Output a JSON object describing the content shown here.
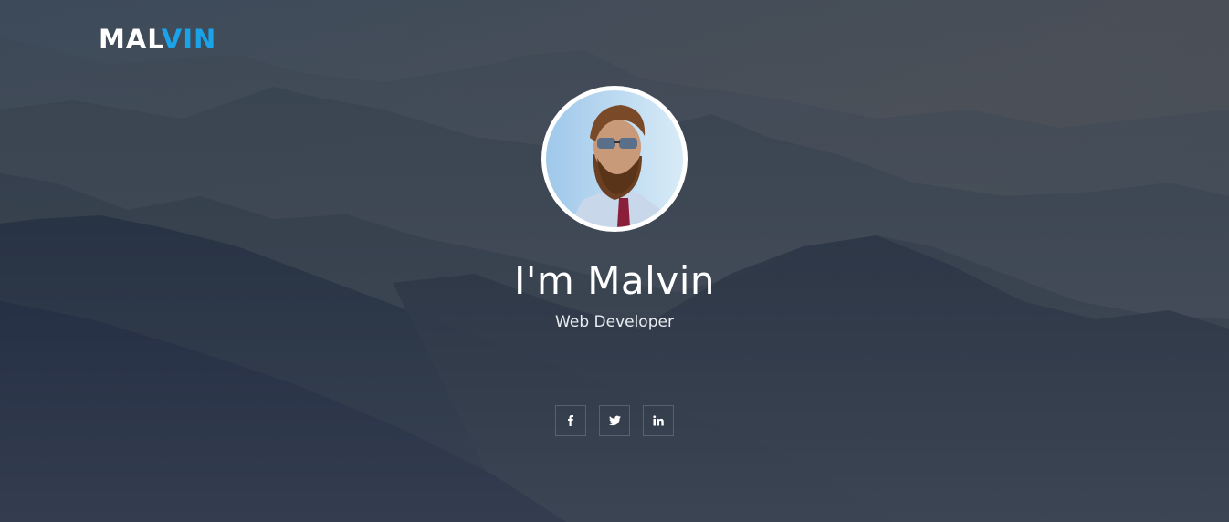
{
  "logo": {
    "part1": "MAL",
    "part2": "VIN"
  },
  "hero": {
    "title": "I'm Malvin",
    "subtitle": "Web Developer"
  },
  "social": [
    {
      "icon": "facebook-icon",
      "glyph": "f"
    },
    {
      "icon": "twitter-icon",
      "glyph": "🐦"
    },
    {
      "icon": "linkedin-icon",
      "glyph": "in"
    }
  ],
  "colors": {
    "accent": "#1aa3e8",
    "background": "#2b3440"
  }
}
